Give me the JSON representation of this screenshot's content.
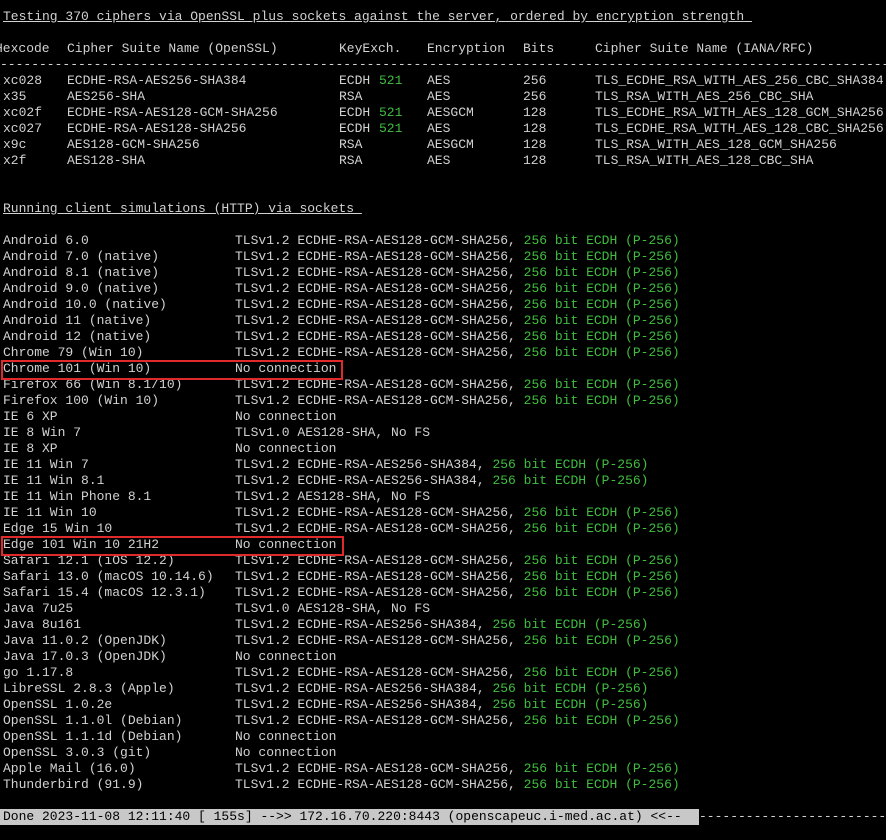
{
  "cipher_section": {
    "title": "Testing 370 ciphers via OpenSSL plus sockets against the server, ordered by encryption strength ",
    "header": {
      "hexcode": "Hexcode",
      "cipher_name": "Cipher Suite Name (OpenSSL)",
      "keyexch": "KeyExch.",
      "encryption": "Encryption",
      "bits": "Bits",
      "iana_name": "Cipher Suite Name (IANA/RFC)"
    },
    "separator": "--------------------------------------------------------------------------------------------------------------------------------",
    "rows": [
      {
        "hex": "xc028",
        "name": "ECDHE-RSA-AES256-SHA384",
        "kx": "ECDH",
        "kx_bits": "521",
        "enc": "AES",
        "bits": "256",
        "iana": "TLS_ECDHE_RSA_WITH_AES_256_CBC_SHA384"
      },
      {
        "hex": "x35",
        "name": "AES256-SHA",
        "kx": "RSA",
        "kx_bits": "",
        "enc": "AES",
        "bits": "256",
        "iana": "TLS_RSA_WITH_AES_256_CBC_SHA"
      },
      {
        "hex": "xc02f",
        "name": "ECDHE-RSA-AES128-GCM-SHA256",
        "kx": "ECDH",
        "kx_bits": "521",
        "enc": "AESGCM",
        "bits": "128",
        "iana": "TLS_ECDHE_RSA_WITH_AES_128_GCM_SHA256"
      },
      {
        "hex": "xc027",
        "name": "ECDHE-RSA-AES128-SHA256",
        "kx": "ECDH",
        "kx_bits": "521",
        "enc": "AES",
        "bits": "128",
        "iana": "TLS_ECDHE_RSA_WITH_AES_128_CBC_SHA256"
      },
      {
        "hex": "x9c",
        "name": "AES128-GCM-SHA256",
        "kx": "RSA",
        "kx_bits": "",
        "enc": "AESGCM",
        "bits": "128",
        "iana": "TLS_RSA_WITH_AES_128_GCM_SHA256"
      },
      {
        "hex": "x2f",
        "name": "AES128-SHA",
        "kx": "RSA",
        "kx_bits": "",
        "enc": "AES",
        "bits": "128",
        "iana": "TLS_RSA_WITH_AES_128_CBC_SHA"
      }
    ]
  },
  "simulation_section": {
    "title": "Running client simulations (HTTP) via sockets ",
    "rows": [
      {
        "client": "Android 6.0",
        "proto": "TLSv1.2 ECDHE-RSA-AES128-GCM-SHA256, ",
        "green": "256 bit ECDH (P-256)"
      },
      {
        "client": "Android 7.0 (native)",
        "proto": "TLSv1.2 ECDHE-RSA-AES128-GCM-SHA256, ",
        "green": "256 bit ECDH (P-256)"
      },
      {
        "client": "Android 8.1 (native)",
        "proto": "TLSv1.2 ECDHE-RSA-AES128-GCM-SHA256, ",
        "green": "256 bit ECDH (P-256)"
      },
      {
        "client": "Android 9.0 (native)",
        "proto": "TLSv1.2 ECDHE-RSA-AES128-GCM-SHA256, ",
        "green": "256 bit ECDH (P-256)"
      },
      {
        "client": "Android 10.0 (native)",
        "proto": "TLSv1.2 ECDHE-RSA-AES128-GCM-SHA256, ",
        "green": "256 bit ECDH (P-256)"
      },
      {
        "client": "Android 11 (native)",
        "proto": "TLSv1.2 ECDHE-RSA-AES128-GCM-SHA256, ",
        "green": "256 bit ECDH (P-256)"
      },
      {
        "client": "Android 12 (native)",
        "proto": "TLSv1.2 ECDHE-RSA-AES128-GCM-SHA256, ",
        "green": "256 bit ECDH (P-256)"
      },
      {
        "client": "Chrome 79 (Win 10)",
        "proto": "TLSv1.2 ECDHE-RSA-AES128-GCM-SHA256, ",
        "green": "256 bit ECDH (P-256)"
      },
      {
        "client": "Chrome 101 (Win 10)",
        "proto": "No connection",
        "green": ""
      },
      {
        "client": "Firefox 66 (Win 8.1/10)",
        "proto": "TLSv1.2 ECDHE-RSA-AES128-GCM-SHA256, ",
        "green": "256 bit ECDH (P-256)"
      },
      {
        "client": "Firefox 100 (Win 10)",
        "proto": "TLSv1.2 ECDHE-RSA-AES128-GCM-SHA256, ",
        "green": "256 bit ECDH (P-256)"
      },
      {
        "client": "IE 6 XP",
        "proto": "No connection",
        "green": ""
      },
      {
        "client": "IE 8 Win 7",
        "proto": "TLSv1.0 AES128-SHA, No FS",
        "green": ""
      },
      {
        "client": "IE 8 XP",
        "proto": "No connection",
        "green": ""
      },
      {
        "client": "IE 11 Win 7",
        "proto": "TLSv1.2 ECDHE-RSA-AES256-SHA384, ",
        "green": "256 bit ECDH (P-256)"
      },
      {
        "client": "IE 11 Win 8.1",
        "proto": "TLSv1.2 ECDHE-RSA-AES256-SHA384, ",
        "green": "256 bit ECDH (P-256)"
      },
      {
        "client": "IE 11 Win Phone 8.1",
        "proto": "TLSv1.2 AES128-SHA, No FS",
        "green": ""
      },
      {
        "client": "IE 11 Win 10",
        "proto": "TLSv1.2 ECDHE-RSA-AES128-GCM-SHA256, ",
        "green": "256 bit ECDH (P-256)"
      },
      {
        "client": "Edge 15 Win 10",
        "proto": "TLSv1.2 ECDHE-RSA-AES128-GCM-SHA256, ",
        "green": "256 bit ECDH (P-256)"
      },
      {
        "client": "Edge 101 Win 10 21H2",
        "proto": "No connection",
        "green": ""
      },
      {
        "client": "Safari 12.1 (iOS 12.2)",
        "proto": "TLSv1.2 ECDHE-RSA-AES128-GCM-SHA256, ",
        "green": "256 bit ECDH (P-256)"
      },
      {
        "client": "Safari 13.0 (macOS 10.14.6)",
        "proto": "TLSv1.2 ECDHE-RSA-AES128-GCM-SHA256, ",
        "green": "256 bit ECDH (P-256)"
      },
      {
        "client": "Safari 15.4 (macOS 12.3.1)",
        "proto": "TLSv1.2 ECDHE-RSA-AES128-GCM-SHA256, ",
        "green": "256 bit ECDH (P-256)"
      },
      {
        "client": "Java 7u25",
        "proto": "TLSv1.0 AES128-SHA, No FS",
        "green": ""
      },
      {
        "client": "Java 8u161",
        "proto": "TLSv1.2 ECDHE-RSA-AES256-SHA384, ",
        "green": "256 bit ECDH (P-256)"
      },
      {
        "client": "Java 11.0.2 (OpenJDK)",
        "proto": "TLSv1.2 ECDHE-RSA-AES128-GCM-SHA256, ",
        "green": "256 bit ECDH (P-256)"
      },
      {
        "client": "Java 17.0.3 (OpenJDK)",
        "proto": "No connection",
        "green": ""
      },
      {
        "client": "go 1.17.8",
        "proto": "TLSv1.2 ECDHE-RSA-AES128-GCM-SHA256, ",
        "green": "256 bit ECDH (P-256)"
      },
      {
        "client": "LibreSSL 2.8.3 (Apple)",
        "proto": "TLSv1.2 ECDHE-RSA-AES256-SHA384, ",
        "green": "256 bit ECDH (P-256)"
      },
      {
        "client": "OpenSSL 1.0.2e",
        "proto": "TLSv1.2 ECDHE-RSA-AES256-SHA384, ",
        "green": "256 bit ECDH (P-256)"
      },
      {
        "client": "OpenSSL 1.1.0l (Debian)",
        "proto": "TLSv1.2 ECDHE-RSA-AES128-GCM-SHA256, ",
        "green": "256 bit ECDH (P-256)"
      },
      {
        "client": "OpenSSL 1.1.1d (Debian)",
        "proto": "No connection",
        "green": ""
      },
      {
        "client": "OpenSSL 3.0.3 (git)",
        "proto": "No connection",
        "green": ""
      },
      {
        "client": "Apple Mail (16.0)",
        "proto": "TLSv1.2 ECDHE-RSA-AES128-GCM-SHA256, ",
        "green": "256 bit ECDH (P-256)"
      },
      {
        "client": "Thunderbird (91.9)",
        "proto": "TLSv1.2 ECDHE-RSA-AES128-GCM-SHA256, ",
        "green": "256 bit ECDH (P-256)"
      }
    ]
  },
  "status": {
    "text": "Done 2023-11-08 12:11:40 [ 155s] -->> 172.16.70.220:8443 (openscapeuc.i-med.ac.at) <<--",
    "trail": "----------------------------------------"
  },
  "colors": {
    "background": "#000000",
    "text": "#d2d2d2",
    "green": "#3fbe3f",
    "highlight_box": "#e0292b",
    "status_bar": "#c8c8c8"
  }
}
